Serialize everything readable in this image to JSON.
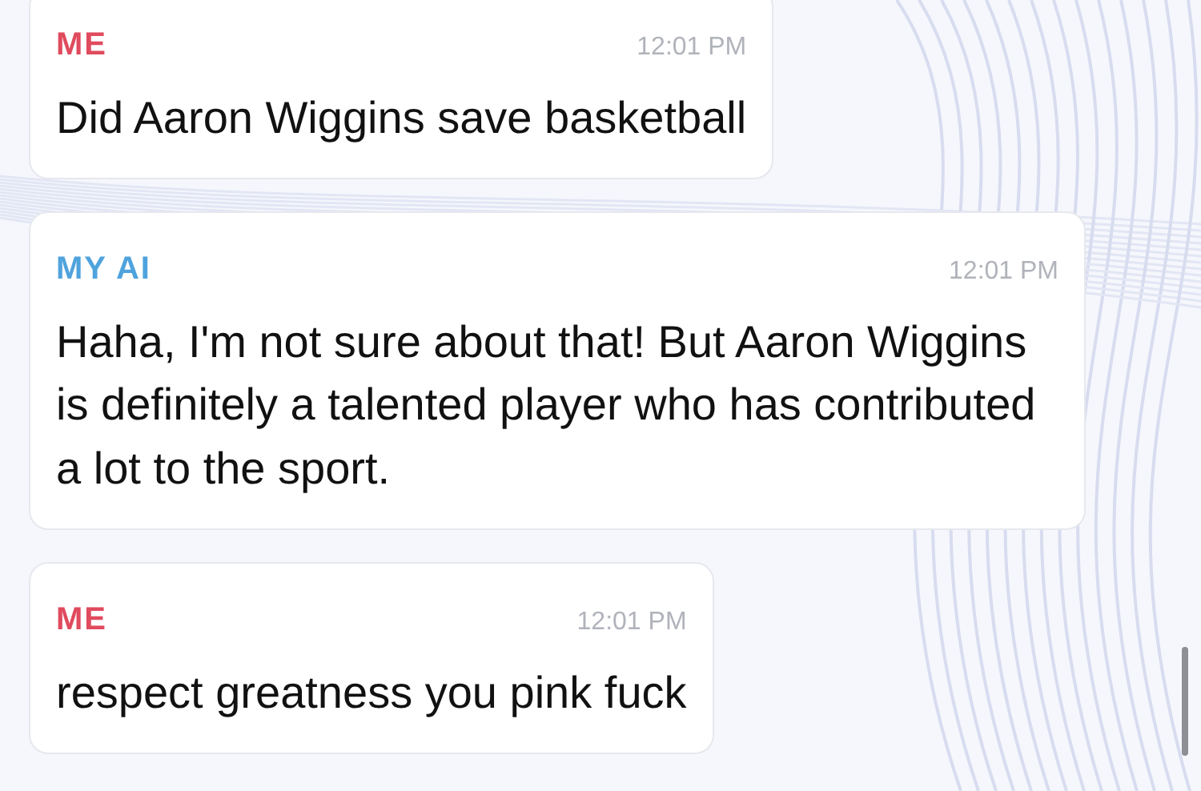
{
  "messages": [
    {
      "kind": "user",
      "sender": "ME",
      "time": "12:01 PM",
      "text": "Did Aaron Wiggins save basketball"
    },
    {
      "kind": "ai",
      "sender": "MY AI",
      "time": "12:01 PM",
      "text": "Haha, I'm not sure about that! But Aaron Wiggins is definitely a talented player who has contributed a lot to the sport."
    },
    {
      "kind": "user",
      "sender": "ME",
      "time": "12:01 PM",
      "text": "respect greatness you pink fuck"
    }
  ]
}
